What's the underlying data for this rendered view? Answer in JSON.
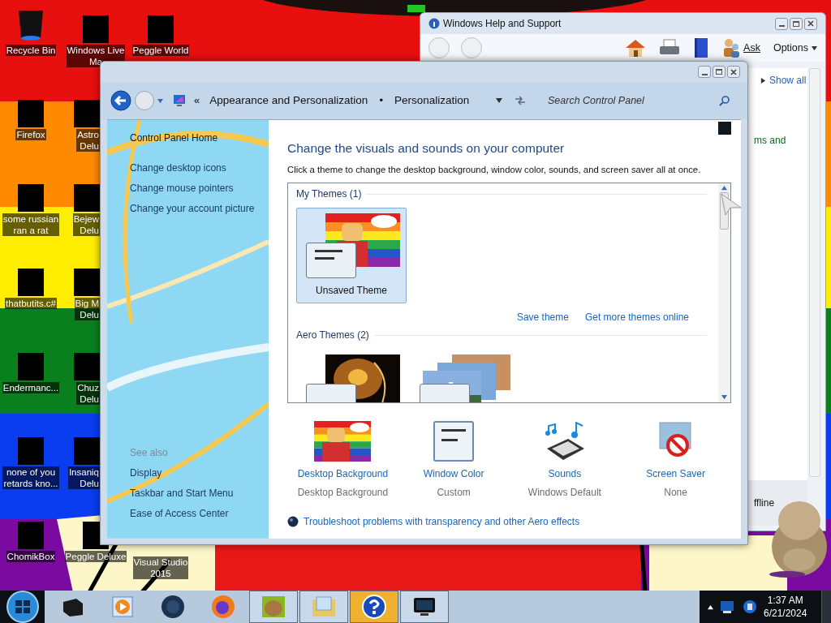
{
  "desktop": {
    "columns": [
      [
        {
          "label": "Recycle Bin",
          "redacted": false
        },
        {
          "label": "Firefox",
          "redacted": true
        },
        {
          "label": "some russian\nran a rat",
          "redacted": true
        },
        {
          "label": "thatbutits.c#",
          "redacted": true
        },
        {
          "label": "Endermanc...",
          "redacted": true
        },
        {
          "label": "none of you\nretards kno...",
          "redacted": true
        },
        {
          "label": "ChomikBox",
          "redacted": true
        }
      ],
      [
        {
          "label": "Windows Live\nMa",
          "redacted": true
        },
        {
          "label": "Astro\nDelu",
          "redacted": true
        },
        {
          "label": "Bejew\nDelu",
          "redacted": true
        },
        {
          "label": "Big M\nDelu",
          "redacted": true
        },
        {
          "label": "Chuz\nDelu",
          "redacted": true
        },
        {
          "label": "Insaniq\nDelu",
          "redacted": true
        },
        {
          "label": "Peggle Deluxe",
          "redacted": true
        }
      ],
      [
        {
          "label": "Peggle World",
          "redacted": true
        },
        {
          "label": "Visual Studio\n2015",
          "redacted": false
        }
      ]
    ]
  },
  "help_window": {
    "title": "Windows Help and Support",
    "ask": "Ask",
    "options": "Options",
    "show_all": "Show all",
    "text_fragment": "ms and",
    "status_fragment": "ffline"
  },
  "control_panel": {
    "overflow": "«",
    "breadcrumb": [
      "Appearance and Personalization",
      "Personalization"
    ],
    "separator": "•",
    "search_placeholder": "Search Control Panel",
    "sidebar": {
      "home": "Control Panel Home",
      "links": [
        "Change desktop icons",
        "Change mouse pointers",
        "Change your account picture"
      ],
      "see_also_title": "See also",
      "see_also": [
        "Display",
        "Taskbar and Start Menu",
        "Ease of Access Center"
      ]
    },
    "heading": "Change the visuals and sounds on your computer",
    "description": "Click a theme to change the desktop background, window color, sounds, and screen saver all at once.",
    "theme_groups": [
      {
        "title": "My Themes (1)",
        "themes": [
          {
            "name": "Unsaved Theme",
            "kind": "custom",
            "selected": true
          }
        ]
      },
      {
        "title": "Aero Themes (2)",
        "themes": [
          {
            "kind": "dark",
            "selected": false
          },
          {
            "kind": "landscape",
            "selected": false
          }
        ]
      }
    ],
    "theme_links": [
      "Save theme",
      "Get more themes online"
    ],
    "settings": [
      {
        "kind": "background",
        "label": "Desktop Background",
        "value": "Desktop Background"
      },
      {
        "kind": "window-color",
        "label": "Window Color",
        "value": "Custom"
      },
      {
        "kind": "sounds",
        "label": "Sounds",
        "value": "Windows Default"
      },
      {
        "kind": "screen-saver",
        "label": "Screen Saver",
        "value": "None"
      }
    ],
    "troubleshoot": "Troubleshoot problems with transparency and other Aero effects"
  },
  "taskbar": {
    "apps": [
      {
        "kind": "box",
        "running": false,
        "active": false
      },
      {
        "kind": "media",
        "running": false,
        "active": false
      },
      {
        "kind": "globe",
        "running": false,
        "active": false
      },
      {
        "kind": "firefox",
        "running": false,
        "active": false
      },
      {
        "kind": "hamster",
        "running": true,
        "active": false
      },
      {
        "kind": "folder",
        "running": true,
        "active": false
      },
      {
        "kind": "help",
        "running": true,
        "active": true
      },
      {
        "kind": "monitor",
        "running": true,
        "active": false
      }
    ],
    "time": "1:37 AM",
    "date": "6/21/2024"
  }
}
